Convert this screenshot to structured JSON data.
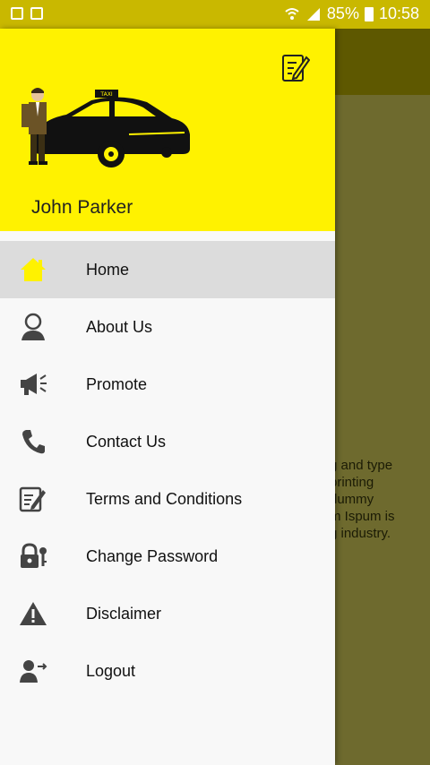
{
  "status_bar": {
    "battery_percent": "85%",
    "time": "10:58"
  },
  "drawer": {
    "user_name": "John Parker",
    "taxi_sign": "TAXI",
    "menu_items": [
      {
        "label": "Home",
        "icon": "home-icon",
        "active": true
      },
      {
        "label": "About Us",
        "icon": "person-icon",
        "active": false
      },
      {
        "label": "Promote",
        "icon": "megaphone-icon",
        "active": false
      },
      {
        "label": "Contact Us",
        "icon": "phone-icon",
        "active": false
      },
      {
        "label": "Terms and Conditions",
        "icon": "document-edit-icon",
        "active": false
      },
      {
        "label": "Change Password",
        "icon": "lock-key-icon",
        "active": false
      },
      {
        "label": "Disclaimer",
        "icon": "warning-icon",
        "active": false
      },
      {
        "label": "Logout",
        "icon": "logout-icon",
        "active": false
      }
    ]
  },
  "background_content": {
    "lines": [
      "g and type",
      "",
      "printing",
      "dummy",
      "m Ispum is",
      "g industry."
    ]
  },
  "colors": {
    "accent": "#fff200",
    "status_bar": "#c9b800",
    "active_item": "#dcdcdc",
    "icon": "#444444"
  }
}
